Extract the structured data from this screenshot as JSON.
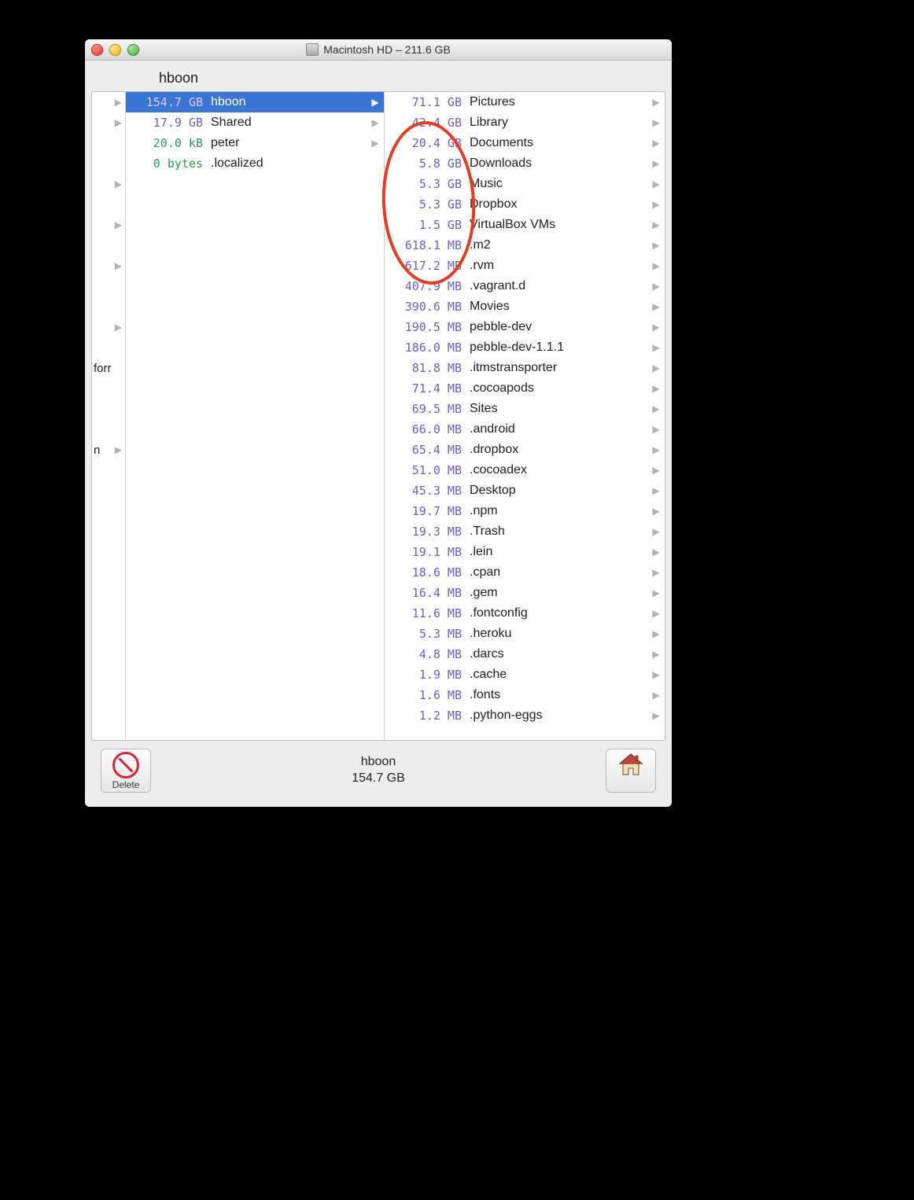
{
  "window": {
    "title": "Macintosh HD – 211.6 GB"
  },
  "path_header": "hboon",
  "col0_stubs": [
    {
      "arrow": true,
      "text": ""
    },
    {
      "arrow": true,
      "text": ""
    },
    {
      "arrow": false,
      "text": ""
    },
    {
      "arrow": false,
      "text": ""
    },
    {
      "arrow": true,
      "text": ""
    },
    {
      "arrow": false,
      "text": ""
    },
    {
      "arrow": true,
      "text": ""
    },
    {
      "arrow": false,
      "text": ""
    },
    {
      "arrow": true,
      "text": ""
    },
    {
      "arrow": false,
      "text": ""
    },
    {
      "arrow": false,
      "text": ""
    },
    {
      "arrow": true,
      "text": ""
    },
    {
      "arrow": false,
      "text": ""
    },
    {
      "arrow": false,
      "text": "forr"
    },
    {
      "arrow": false,
      "text": ""
    },
    {
      "arrow": false,
      "text": ""
    },
    {
      "arrow": false,
      "text": ""
    },
    {
      "arrow": true,
      "text": "n"
    }
  ],
  "col1": [
    {
      "size": "154.7 GB",
      "name": "hboon",
      "selected": true,
      "arrow": true,
      "sizeClass": ""
    },
    {
      "size": "17.9 GB",
      "name": "Shared",
      "selected": false,
      "arrow": true,
      "sizeClass": ""
    },
    {
      "size": "20.0 kB",
      "name": "peter",
      "selected": false,
      "arrow": true,
      "sizeClass": "green"
    },
    {
      "size": "0 bytes",
      "name": ".localized",
      "selected": false,
      "arrow": false,
      "sizeClass": "zero"
    }
  ],
  "col2": [
    {
      "size": "71.1 GB",
      "name": "Pictures",
      "arrow": true
    },
    {
      "size": "42.4 GB",
      "name": "Library",
      "arrow": true
    },
    {
      "size": "20.4 GB",
      "name": "Documents",
      "arrow": true
    },
    {
      "size": "5.8 GB",
      "name": "Downloads",
      "arrow": true
    },
    {
      "size": "5.3 GB",
      "name": "Music",
      "arrow": true
    },
    {
      "size": "5.3 GB",
      "name": "Dropbox",
      "arrow": true
    },
    {
      "size": "1.5 GB",
      "name": "VirtualBox VMs",
      "arrow": true
    },
    {
      "size": "618.1 MB",
      "name": ".m2",
      "arrow": true
    },
    {
      "size": "617.2 MB",
      "name": ".rvm",
      "arrow": true
    },
    {
      "size": "407.9 MB",
      "name": ".vagrant.d",
      "arrow": true
    },
    {
      "size": "390.6 MB",
      "name": "Movies",
      "arrow": true
    },
    {
      "size": "190.5 MB",
      "name": "pebble-dev",
      "arrow": true
    },
    {
      "size": "186.0 MB",
      "name": "pebble-dev-1.1.1",
      "arrow": true
    },
    {
      "size": "81.8 MB",
      "name": ".itmstransporter",
      "arrow": true
    },
    {
      "size": "71.4 MB",
      "name": ".cocoapods",
      "arrow": true
    },
    {
      "size": "69.5 MB",
      "name": "Sites",
      "arrow": true
    },
    {
      "size": "66.0 MB",
      "name": ".android",
      "arrow": true
    },
    {
      "size": "65.4 MB",
      "name": ".dropbox",
      "arrow": true
    },
    {
      "size": "51.0 MB",
      "name": ".cocoadex",
      "arrow": true
    },
    {
      "size": "45.3 MB",
      "name": "Desktop",
      "arrow": true
    },
    {
      "size": "19.7 MB",
      "name": ".npm",
      "arrow": true
    },
    {
      "size": "19.3 MB",
      "name": ".Trash",
      "arrow": true
    },
    {
      "size": "19.1 MB",
      "name": ".lein",
      "arrow": true
    },
    {
      "size": "18.6 MB",
      "name": ".cpan",
      "arrow": true
    },
    {
      "size": "16.4 MB",
      "name": ".gem",
      "arrow": true
    },
    {
      "size": "11.6 MB",
      "name": ".fontconfig",
      "arrow": true
    },
    {
      "size": "5.3 MB",
      "name": ".heroku",
      "arrow": true
    },
    {
      "size": "4.8 MB",
      "name": ".darcs",
      "arrow": true
    },
    {
      "size": "1.9 MB",
      "name": ".cache",
      "arrow": true
    },
    {
      "size": "1.6 MB",
      "name": ".fonts",
      "arrow": true
    },
    {
      "size": "1.2 MB",
      "name": ".python-eggs",
      "arrow": true
    }
  ],
  "footer": {
    "selected_name": "hboon",
    "selected_size": "154.7 GB",
    "delete_label": "Delete"
  }
}
